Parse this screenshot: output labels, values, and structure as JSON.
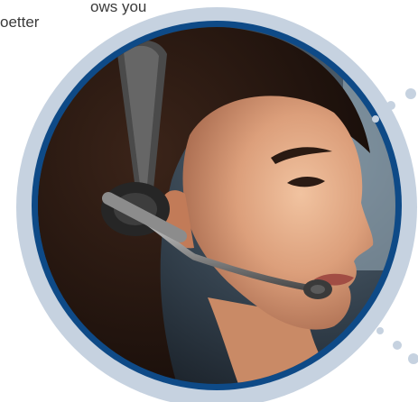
{
  "snippet": {
    "line_1": "ows you",
    "line_2": "oetter"
  },
  "photo": {
    "subject": "woman-with-headset",
    "frame_colors": {
      "outer_ring": "#c6d2e0",
      "inner_ring": "#0e4a87",
      "dots": "#c6d2e0"
    }
  }
}
